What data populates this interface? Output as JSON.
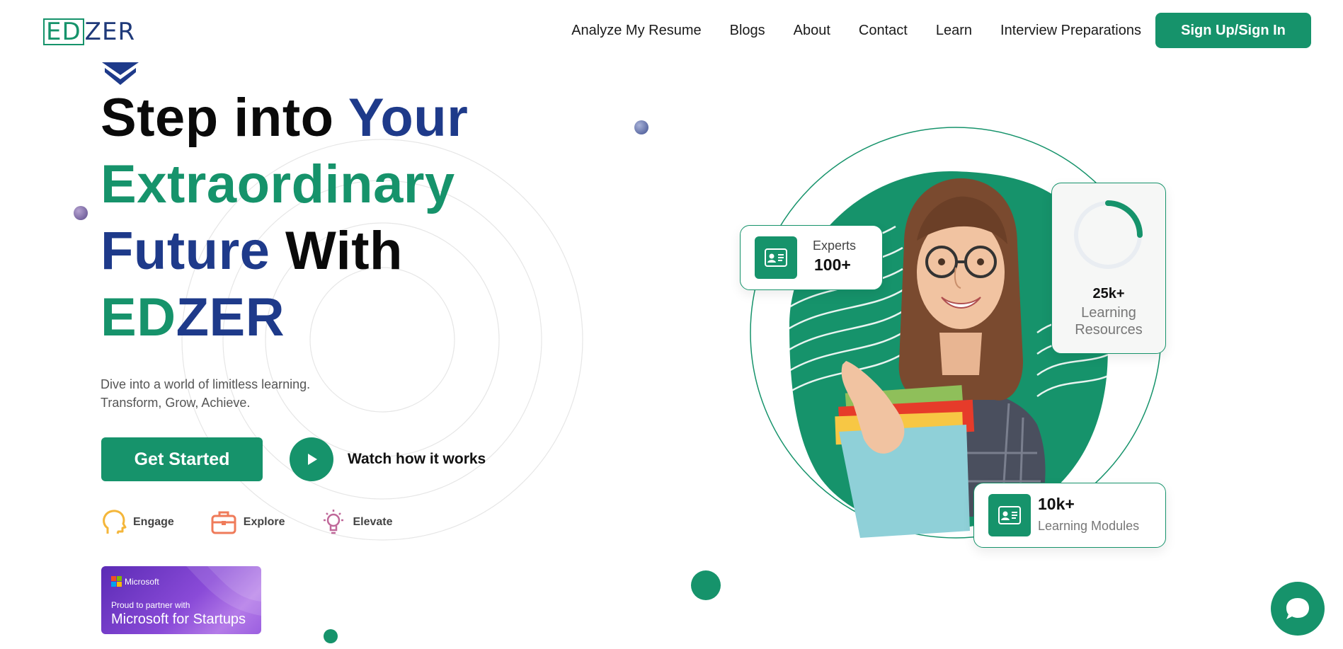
{
  "brand": {
    "logo_boxed": "ED",
    "logo_rest": "ZER"
  },
  "nav": {
    "items": [
      "Analyze My Resume",
      "Blogs",
      "About",
      "Contact",
      "Learn",
      "Interview Preparations"
    ],
    "signup_label": "Sign Up/Sign In"
  },
  "hero": {
    "line1_a": "Step into ",
    "line1_b": "Your",
    "line2": "Extraordinary",
    "line3_a": "Future",
    "line3_b": " With",
    "line4_a": "ED",
    "line4_b": "ZER",
    "subtext_line1": "Dive into a world of limitless learning.",
    "subtext_line2": "Transform, Grow, Achieve.",
    "cta_label": "Get Started",
    "watch_label": "Watch how it works"
  },
  "features": [
    "Engage",
    "Explore",
    "Elevate"
  ],
  "partner": {
    "brand": "Microsoft",
    "tagline": "Proud to partner with",
    "program": "Microsoft for Startups"
  },
  "stats": {
    "experts_label": "Experts",
    "experts_value": "100+",
    "resources_value": "25k+",
    "resources_label_1": "Learning",
    "resources_label_2": "Resources",
    "modules_value": "10k+",
    "modules_label": "Learning Modules"
  },
  "colors": {
    "primary_green": "#16936b",
    "navy": "#1e3a8a"
  },
  "icons": {
    "hero": "graduation-cap-icon",
    "engage": "head-profile-icon",
    "explore": "briefcase-icon",
    "elevate": "lightbulb-icon",
    "stat": "id-card-icon",
    "chat": "chat-bubble-icon"
  }
}
